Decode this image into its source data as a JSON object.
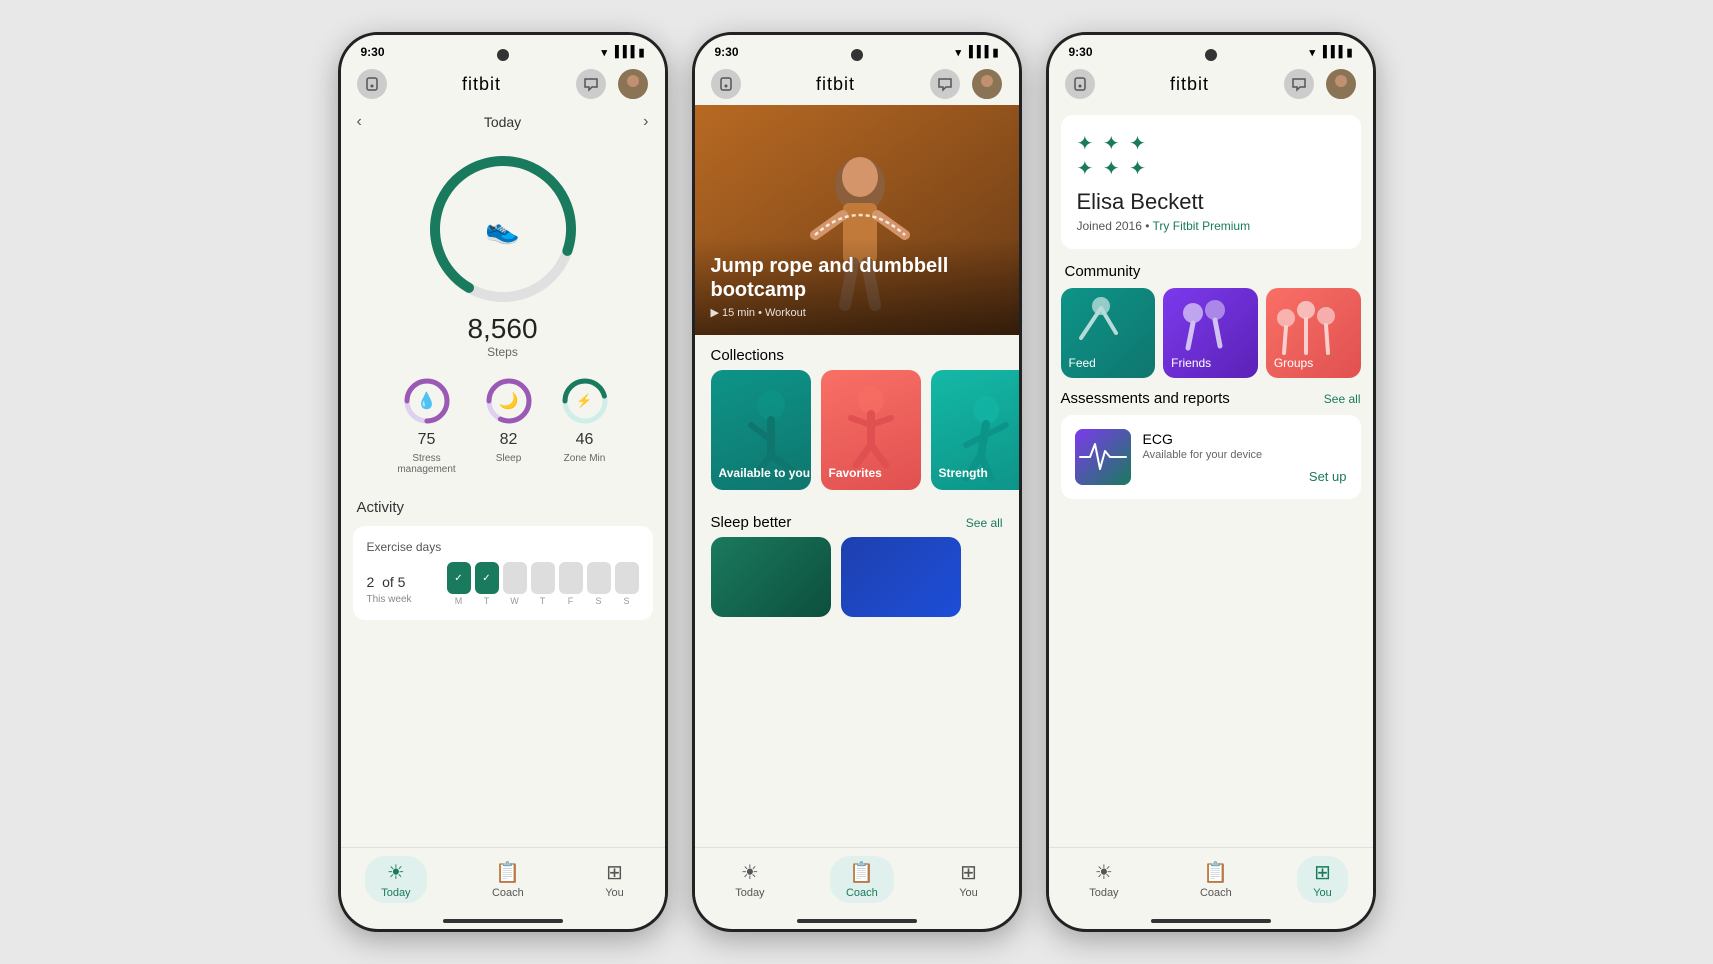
{
  "brand": "fitbit",
  "time": "9:30",
  "screens": [
    {
      "id": "today",
      "active_tab": "Today",
      "nav": {
        "left_icon": "device-icon",
        "right_icon": "message-icon",
        "avatar": true
      },
      "date_nav": {
        "prev": "<",
        "label": "Today",
        "next": ">"
      },
      "steps": {
        "value": "8,560",
        "label": "Steps",
        "progress": 0.72
      },
      "metrics": [
        {
          "value": "75",
          "label": "Stress management",
          "color": "#7c3aed",
          "progress": 0.75,
          "icon": "💧"
        },
        {
          "value": "82",
          "label": "Sleep",
          "color": "#7c3aed",
          "progress": 0.82,
          "icon": "🌙"
        },
        {
          "value": "46",
          "label": "Zone Min",
          "color": "#1a7a5e",
          "progress": 0.46,
          "icon": "⚡"
        }
      ],
      "activity": {
        "header": "Activity",
        "exercise_days": {
          "title": "Exercise days",
          "count": "2",
          "of": "of",
          "total": "5",
          "week_label": "This week",
          "days": [
            {
              "label": "M",
              "filled": true,
              "check": true
            },
            {
              "label": "T",
              "filled": true,
              "check": true
            },
            {
              "label": "W",
              "filled": false
            },
            {
              "label": "T",
              "filled": false
            },
            {
              "label": "F",
              "filled": false
            },
            {
              "label": "S",
              "filled": false
            },
            {
              "label": "S",
              "filled": false
            }
          ]
        }
      },
      "tabs": [
        {
          "id": "today",
          "label": "Today",
          "active": true
        },
        {
          "id": "coach",
          "label": "Coach",
          "active": false
        },
        {
          "id": "you",
          "label": "You",
          "active": false
        }
      ]
    },
    {
      "id": "coach",
      "active_tab": "Coach",
      "hero": {
        "title": "Jump rope and dumbbell bootcamp",
        "subtitle": "15 min • Workout"
      },
      "collections": {
        "header": "Collections",
        "items": [
          {
            "label": "Available to you",
            "color": "teal"
          },
          {
            "label": "Favorites",
            "color": "salmon"
          },
          {
            "label": "Strength",
            "color": "teal2"
          }
        ]
      },
      "sleep_better": {
        "header": "Sleep better",
        "see_all": "See all"
      },
      "tabs": [
        {
          "id": "today",
          "label": "Today",
          "active": false
        },
        {
          "id": "coach",
          "label": "Coach",
          "active": true
        },
        {
          "id": "you",
          "label": "You",
          "active": false
        }
      ]
    },
    {
      "id": "you",
      "active_tab": "You",
      "profile": {
        "name": "Elisa Beckett",
        "joined": "Joined 2016 • ",
        "premium_link": "Try Fitbit Premium"
      },
      "community": {
        "header": "Community",
        "items": [
          {
            "label": "Feed",
            "color": "teal"
          },
          {
            "label": "Friends",
            "color": "purple"
          },
          {
            "label": "Groups",
            "color": "salmon"
          }
        ]
      },
      "assessments": {
        "header": "Assessments and reports",
        "see_all": "See all",
        "items": [
          {
            "name": "ECG",
            "subtitle": "Available for your device",
            "action": "Set up"
          }
        ]
      },
      "tabs": [
        {
          "id": "today",
          "label": "Today",
          "active": false
        },
        {
          "id": "coach",
          "label": "Coach",
          "active": false
        },
        {
          "id": "you",
          "label": "You",
          "active": true
        }
      ]
    }
  ]
}
